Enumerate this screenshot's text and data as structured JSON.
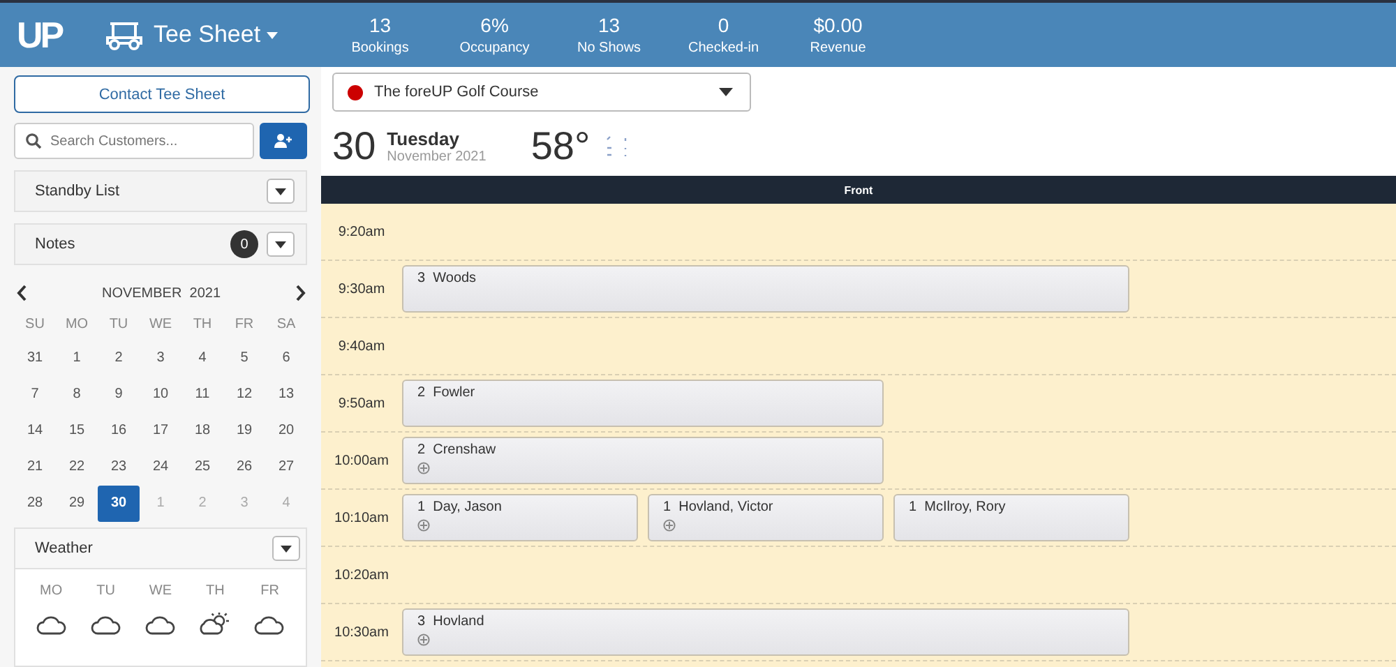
{
  "header": {
    "logo": "UP",
    "title": "Tee Sheet",
    "stats": [
      {
        "value": "13",
        "label": "Bookings"
      },
      {
        "value": "6%",
        "label": "Occupancy"
      },
      {
        "value": "13",
        "label": "No Shows"
      },
      {
        "value": "0",
        "label": "Checked-in"
      },
      {
        "value": "$0.00",
        "label": "Revenue"
      }
    ]
  },
  "sidebar": {
    "contact_button": "Contact Tee Sheet",
    "search": {
      "placeholder": "Search Customers..."
    },
    "panels": [
      {
        "label": "Standby List"
      },
      {
        "label": "Notes",
        "count": "0"
      }
    ],
    "calendar": {
      "month": "NOVEMBER  2021",
      "weekdays": [
        "SU",
        "MO",
        "TU",
        "WE",
        "TH",
        "FR",
        "SA"
      ],
      "days": [
        {
          "day": "31",
          "muted": false,
          "selected": false
        },
        {
          "day": "1",
          "muted": false,
          "selected": false
        },
        {
          "day": "2",
          "muted": false,
          "selected": false
        },
        {
          "day": "3",
          "muted": false,
          "selected": false
        },
        {
          "day": "4",
          "muted": false,
          "selected": false
        },
        {
          "day": "5",
          "muted": false,
          "selected": false
        },
        {
          "day": "6",
          "muted": false,
          "selected": false
        },
        {
          "day": "7",
          "muted": false,
          "selected": false
        },
        {
          "day": "8",
          "muted": false,
          "selected": false
        },
        {
          "day": "9",
          "muted": false,
          "selected": false
        },
        {
          "day": "10",
          "muted": false,
          "selected": false
        },
        {
          "day": "11",
          "muted": false,
          "selected": false
        },
        {
          "day": "12",
          "muted": false,
          "selected": false
        },
        {
          "day": "13",
          "muted": false,
          "selected": false
        },
        {
          "day": "14",
          "muted": false,
          "selected": false
        },
        {
          "day": "15",
          "muted": false,
          "selected": false
        },
        {
          "day": "16",
          "muted": false,
          "selected": false
        },
        {
          "day": "17",
          "muted": false,
          "selected": false
        },
        {
          "day": "18",
          "muted": false,
          "selected": false
        },
        {
          "day": "19",
          "muted": false,
          "selected": false
        },
        {
          "day": "20",
          "muted": false,
          "selected": false
        },
        {
          "day": "21",
          "muted": false,
          "selected": false
        },
        {
          "day": "22",
          "muted": false,
          "selected": false
        },
        {
          "day": "23",
          "muted": false,
          "selected": false
        },
        {
          "day": "24",
          "muted": false,
          "selected": false
        },
        {
          "day": "25",
          "muted": false,
          "selected": false
        },
        {
          "day": "26",
          "muted": false,
          "selected": false
        },
        {
          "day": "27",
          "muted": false,
          "selected": false
        },
        {
          "day": "28",
          "muted": false,
          "selected": false
        },
        {
          "day": "29",
          "muted": false,
          "selected": false
        },
        {
          "day": "30",
          "muted": false,
          "selected": true
        },
        {
          "day": "1",
          "muted": true,
          "selected": false
        },
        {
          "day": "2",
          "muted": true,
          "selected": false
        },
        {
          "day": "3",
          "muted": true,
          "selected": false
        },
        {
          "day": "4",
          "muted": true,
          "selected": false
        }
      ]
    },
    "weather": {
      "label": "Weather",
      "days": [
        {
          "day": "MO",
          "kind": "cloud"
        },
        {
          "day": "TU",
          "kind": "cloud"
        },
        {
          "day": "WE",
          "kind": "cloud"
        },
        {
          "day": "TH",
          "kind": "sun-cloud"
        },
        {
          "day": "FR",
          "kind": "cloud"
        }
      ]
    }
  },
  "course_select": {
    "value": "The foreUP Golf Course",
    "color": "#cc0000"
  },
  "date": {
    "day": "30",
    "weekday": "Tuesday",
    "month_year": "November 2021",
    "temperature": "58°"
  },
  "tee_sheet": {
    "column": "Front",
    "rows": [
      {
        "time": "9:20am",
        "bookings": []
      },
      {
        "time": "9:30am",
        "bookings": [
          {
            "players": "3",
            "name": "Woods",
            "badge": false
          }
        ]
      },
      {
        "time": "9:40am",
        "bookings": []
      },
      {
        "time": "9:50am",
        "bookings": [
          {
            "players": "2",
            "name": "Fowler",
            "badge": false
          }
        ]
      },
      {
        "time": "10:00am",
        "bookings": [
          {
            "players": "2",
            "name": "Crenshaw",
            "badge": true
          }
        ]
      },
      {
        "time": "10:10am",
        "bookings": [
          {
            "players": "1",
            "name": "Day, Jason",
            "badge": true
          },
          {
            "players": "1",
            "name": "Hovland, Victor",
            "badge": true
          },
          {
            "players": "1",
            "name": "McIlroy, Rory",
            "badge": false
          }
        ]
      },
      {
        "time": "10:20am",
        "bookings": []
      },
      {
        "time": "10:30am",
        "bookings": [
          {
            "players": "3",
            "name": "Hovland",
            "badge": true
          }
        ]
      }
    ]
  }
}
